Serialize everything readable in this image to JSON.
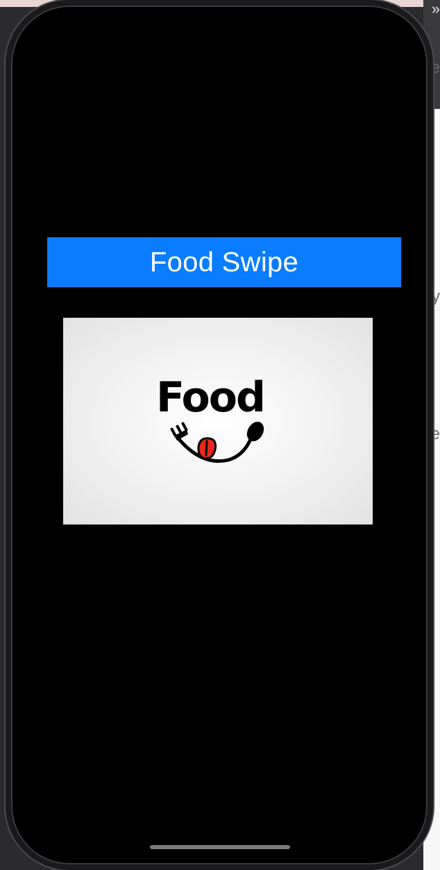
{
  "app": {
    "title": "Food Swipe"
  },
  "hero_image": {
    "logo_text": "Food",
    "icon": "fork-spoon-smile-icon"
  },
  "colors": {
    "title_bar": "#0a7cff",
    "screen_background": "#000000",
    "tongue": "#e8281f"
  },
  "edge_background": {
    "top_char": "»",
    "chars": [
      "e",
      "y",
      "e"
    ]
  }
}
